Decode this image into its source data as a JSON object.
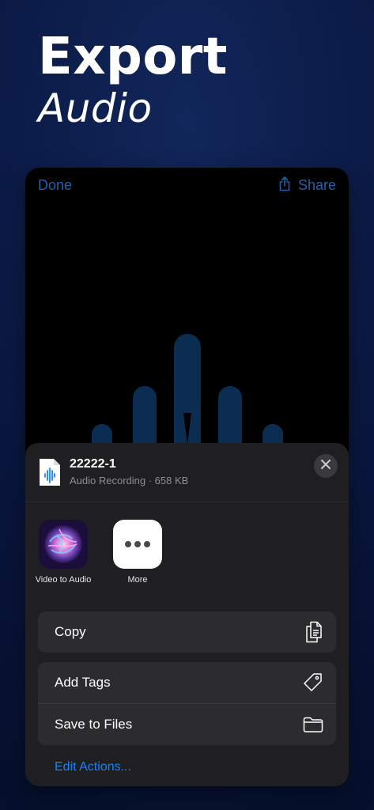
{
  "promo": {
    "title_line1": "Export",
    "title_line2": "Audio"
  },
  "topbar": {
    "done_label": "Done",
    "share_label": "Share",
    "share_icon": "share-icon"
  },
  "sheet": {
    "file": {
      "name": "22222-1",
      "meta": "Audio Recording · 658 KB",
      "icon": "audio-file-icon"
    },
    "close_icon": "close-icon",
    "apps": [
      {
        "label": "Video to Audio",
        "icon": "video-to-audio-app-icon"
      },
      {
        "label": "More",
        "icon": "more-icon"
      }
    ],
    "actions": {
      "copy_label": "Copy",
      "add_tags_label": "Add Tags",
      "save_to_files_label": "Save to Files"
    },
    "edit_actions_label": "Edit Actions..."
  },
  "colors": {
    "accent": "#1a82f7",
    "muted_accent": "#2460a8",
    "sheet_bg": "#1f1f21",
    "row_bg": "#2c2c2e",
    "waveform": "#0b2d52"
  }
}
